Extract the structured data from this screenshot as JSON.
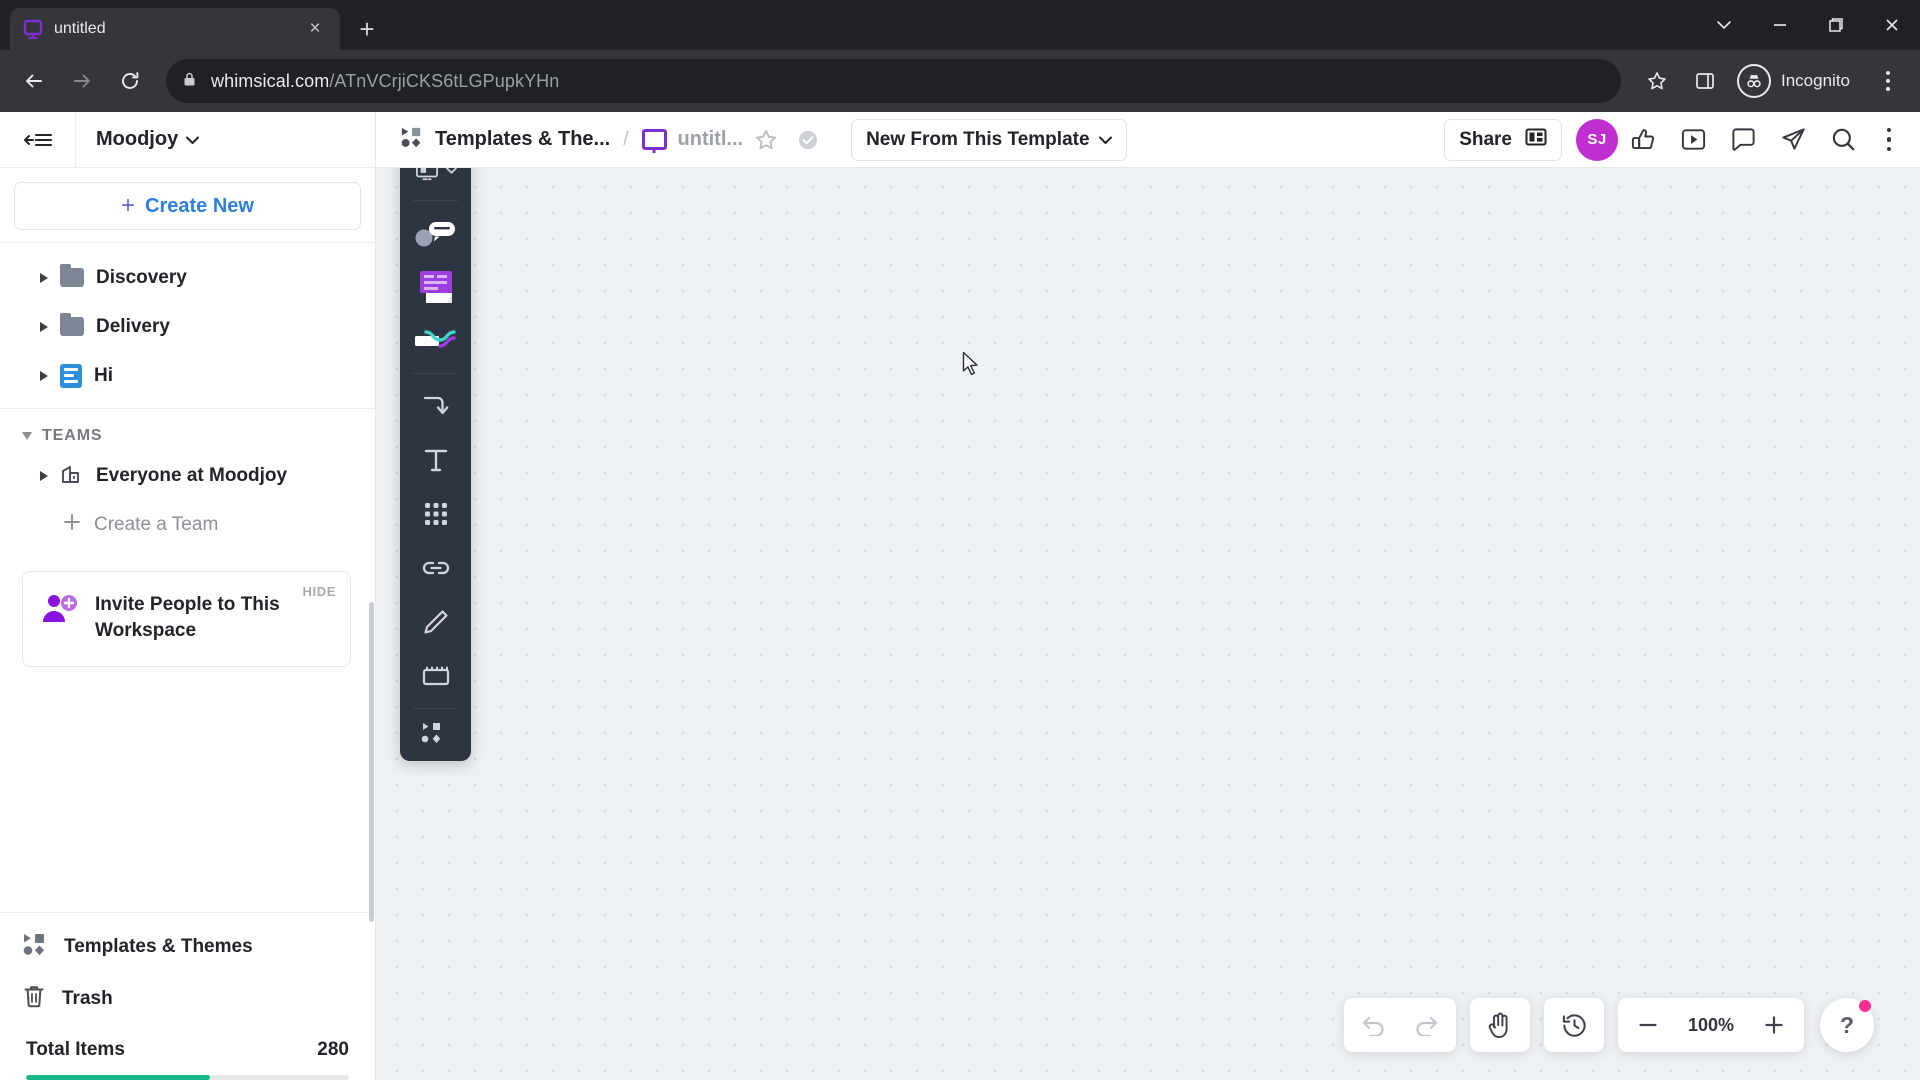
{
  "browser": {
    "tab": {
      "title": "untitled",
      "favicon": "whimsical-logo-icon",
      "close_label": "×"
    },
    "new_tab_label": "+",
    "window_controls": {
      "expand": "v",
      "minimize": "—",
      "maximize": "❐",
      "close": "✕"
    },
    "nav": {
      "back": "←",
      "forward": "→",
      "reload": "⟳"
    },
    "omnibox": {
      "lock_icon": "lock-icon",
      "domain": "whimsical.com",
      "path": "/ATnVCrjiCKS6tLGPupkYHn",
      "full_url": "whimsical.com/ATnVCrjiCKS6tLGPupkYHn"
    },
    "bookmark_icon": "star-icon",
    "side_panel_icon": "side-panel-icon",
    "profile": {
      "label": "Incognito",
      "icon": "incognito-icon"
    },
    "menu_icon": "kebab-menu-icon"
  },
  "sidebar": {
    "collapse_icon": "collapse-sidebar-icon",
    "workspace": {
      "name": "Moodjoy",
      "chevron": "⌄"
    },
    "create_new": {
      "label": "Create New",
      "plus": "+"
    },
    "tree": [
      {
        "label": "Discovery",
        "icon": "folder-icon",
        "expanded": false
      },
      {
        "label": "Delivery",
        "icon": "folder-icon",
        "expanded": false
      },
      {
        "label": "Hi",
        "icon": "document-icon",
        "expanded": false
      }
    ],
    "teams": {
      "header": "TEAMS",
      "items": [
        {
          "label": "Everyone at Moodjoy",
          "icon": "team-icon"
        }
      ],
      "create_team": {
        "label": "Create a Team",
        "plus": "+"
      }
    },
    "invite_card": {
      "title": "Invite People to This Workspace",
      "hide_label": "HIDE",
      "icon": "add-person-icon"
    },
    "bottom_items": [
      {
        "label": "Templates & Themes",
        "icon": "templates-icon"
      },
      {
        "label": "Trash",
        "icon": "trash-icon"
      }
    ],
    "total": {
      "label": "Total Items",
      "value": "280",
      "progress_percent": 57,
      "bar_color": "#19b88a"
    }
  },
  "appbar": {
    "breadcrumb": {
      "root": {
        "label": "Templates & The...",
        "icon": "templates-icon"
      },
      "separator": "/",
      "current": {
        "label": "untitl...",
        "icon": "board-icon"
      }
    },
    "star_icon": "star-icon",
    "status_icon": "saved-check-icon",
    "template_button": {
      "label": "New From This Template",
      "chevron": "⌄"
    },
    "share_button": {
      "label": "Share",
      "icon": "share-panel-icon"
    },
    "avatar": {
      "initials": "SJ",
      "color": "#c02ed0"
    },
    "icons": [
      {
        "name": "thumbs-up-icon"
      },
      {
        "name": "present-icon"
      },
      {
        "name": "comment-icon"
      },
      {
        "name": "send-icon"
      },
      {
        "name": "search-icon"
      }
    ],
    "menu_icon": "kebab-menu-icon"
  },
  "toolrail": {
    "items": [
      {
        "name": "board-select-tool",
        "chevron": "⌄"
      },
      {
        "name": "sticky-note-tool"
      },
      {
        "name": "card-tool"
      },
      {
        "name": "shape-tool"
      },
      {
        "name": "connector-tool"
      },
      {
        "name": "text-tool",
        "glyph": "T"
      },
      {
        "name": "grid-tool"
      },
      {
        "name": "link-tool"
      },
      {
        "name": "pen-tool"
      },
      {
        "name": "frame-tool"
      },
      {
        "name": "more-tools"
      }
    ]
  },
  "canvas_controls": {
    "undo": {
      "name": "undo-icon"
    },
    "redo": {
      "name": "redo-icon"
    },
    "hand": {
      "name": "hand-tool-icon"
    },
    "history": {
      "name": "history-icon"
    },
    "zoom_out": "−",
    "zoom_level": "100%",
    "zoom_in": "+",
    "help": {
      "label": "?",
      "badge_color": "#ff2d92"
    }
  }
}
